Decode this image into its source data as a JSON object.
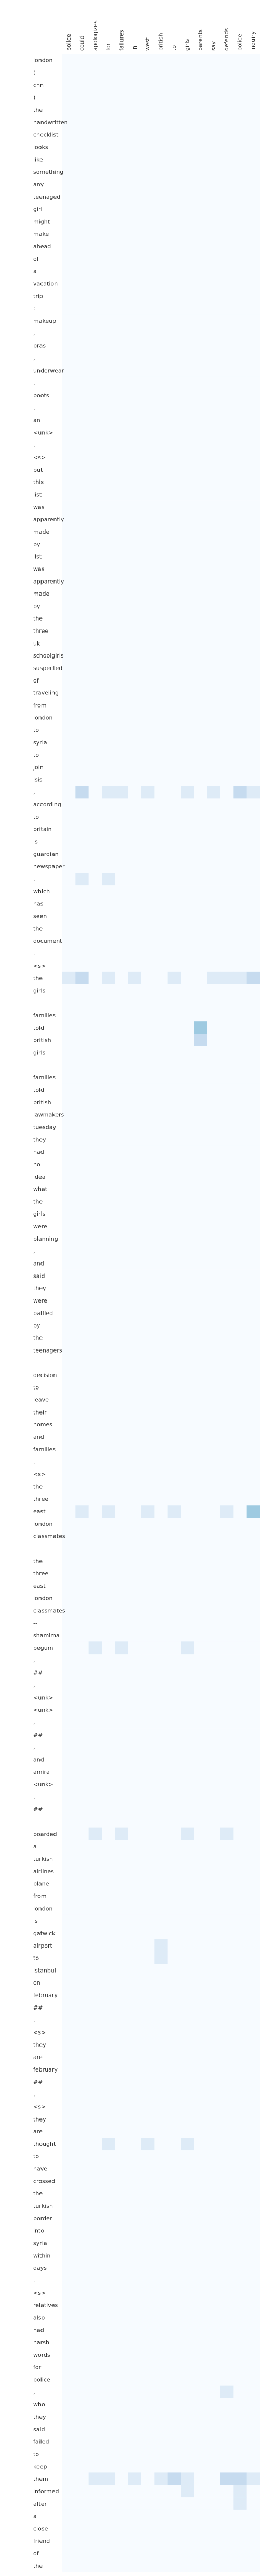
{
  "chart_data": {
    "type": "heatmap",
    "title": "",
    "xlabel": "",
    "ylabel": "",
    "colormap": [
      "#f7fbff",
      "#deebf7",
      "#c6dbef",
      "#9ecae1"
    ],
    "x_labels": [
      "police",
      "could",
      "apologizes",
      "for",
      "failures",
      "in",
      "west",
      "british",
      "to",
      "girls",
      "parents",
      "say",
      "defends",
      "police",
      "inquiry"
    ],
    "y_labels": [
      "london",
      "(",
      "cnn",
      ")",
      "the",
      "handwritten",
      "checklist",
      "looks",
      "like",
      "something",
      "any",
      "teenaged",
      "girl",
      "might",
      "make",
      "ahead",
      "of",
      "a",
      "vacation",
      "trip",
      ":",
      "makeup",
      ",",
      "bras",
      ",",
      "underwear",
      ",",
      "boots",
      ",",
      "an",
      "<unk>",
      ".",
      "<s>",
      "but",
      "this",
      "list",
      "was",
      "apparently",
      "made",
      "by",
      "list",
      "was",
      "apparently",
      "made",
      "by",
      "the",
      "three",
      "uk",
      "schoolgirls",
      "suspected",
      "of",
      "traveling",
      "from",
      "london",
      "to",
      "syria",
      "to",
      "join",
      "isis",
      ",",
      "according",
      "to",
      "britain",
      "'s",
      "guardian",
      "newspaper",
      ",",
      "which",
      "has",
      "seen",
      "the",
      "document",
      ".",
      "<s>",
      "the",
      "girls",
      "'",
      "families",
      "told",
      "british",
      "girls",
      "'",
      "families",
      "told",
      "british",
      "lawmakers",
      "tuesday",
      "they",
      "had",
      "no",
      "idea",
      "what",
      "the",
      "girls",
      "were",
      "planning",
      ",",
      "and",
      "said",
      "they",
      "were",
      "baffled",
      "by",
      "the",
      "teenagers",
      "'",
      "decision",
      "to",
      "leave",
      "their",
      "homes",
      "and",
      "families",
      ".",
      "<s>",
      "the",
      "three",
      "east",
      "london",
      "classmates",
      "--",
      "the",
      "three",
      "east",
      "london",
      "classmates",
      "--",
      "shamima",
      "begum",
      ",",
      "##",
      ",",
      "<unk>",
      "<unk>",
      ",",
      "##",
      ",",
      "and",
      "amira",
      "<unk>",
      ",",
      "##",
      "--",
      "boarded",
      "a",
      "turkish",
      "airlines",
      "plane",
      "from",
      "london",
      "'s",
      "gatwick",
      "airport",
      "to",
      "istanbul",
      "on",
      "february",
      "##",
      ".",
      "<s>",
      "they",
      "are",
      "february",
      "##",
      ".",
      "<s>",
      "they",
      "are",
      "thought",
      "to",
      "have",
      "crossed",
      "the",
      "turkish",
      "border",
      "into",
      "syria",
      "within",
      "days",
      ".",
      "<s>",
      "relatives",
      "also",
      "had",
      "harsh",
      "words",
      "for",
      "police",
      ",",
      "who",
      "they",
      "said",
      "failed",
      "to",
      "keep",
      "them",
      "informed",
      "after",
      "a",
      "close",
      "friend",
      "of",
      "the"
    ],
    "strong_cells": [
      [
        59,
        1,
        2
      ],
      [
        59,
        3,
        1
      ],
      [
        59,
        4,
        1
      ],
      [
        59,
        6,
        1
      ],
      [
        59,
        9,
        1
      ],
      [
        59,
        11,
        1
      ],
      [
        59,
        13,
        2
      ],
      [
        59,
        14,
        1
      ],
      [
        66,
        1,
        1
      ],
      [
        66,
        3,
        1
      ],
      [
        74,
        0,
        1
      ],
      [
        74,
        1,
        2
      ],
      [
        74,
        3,
        1
      ],
      [
        74,
        5,
        1
      ],
      [
        74,
        8,
        1
      ],
      [
        74,
        11,
        1
      ],
      [
        74,
        12,
        1
      ],
      [
        74,
        13,
        1
      ],
      [
        74,
        14,
        2
      ],
      [
        78,
        10,
        3
      ],
      [
        79,
        10,
        2
      ],
      [
        117,
        1,
        1
      ],
      [
        117,
        3,
        1
      ],
      [
        117,
        6,
        1
      ],
      [
        117,
        8,
        1
      ],
      [
        117,
        12,
        1
      ],
      [
        117,
        14,
        3
      ],
      [
        128,
        2,
        1
      ],
      [
        128,
        4,
        1
      ],
      [
        128,
        9,
        1
      ],
      [
        143,
        2,
        1
      ],
      [
        143,
        4,
        1
      ],
      [
        143,
        9,
        1
      ],
      [
        143,
        12,
        1
      ],
      [
        152,
        7,
        1
      ],
      [
        153,
        7,
        1
      ],
      [
        168,
        3,
        1
      ],
      [
        168,
        6,
        1
      ],
      [
        168,
        9,
        1
      ],
      [
        188,
        12,
        1
      ],
      [
        195,
        2,
        1
      ],
      [
        195,
        3,
        1
      ],
      [
        195,
        5,
        1
      ],
      [
        195,
        7,
        1
      ],
      [
        195,
        8,
        2
      ],
      [
        195,
        9,
        1
      ],
      [
        195,
        12,
        2
      ],
      [
        195,
        13,
        2
      ],
      [
        195,
        14,
        1
      ],
      [
        196,
        9,
        1
      ],
      [
        196,
        13,
        1
      ],
      [
        197,
        13,
        1
      ]
    ]
  }
}
